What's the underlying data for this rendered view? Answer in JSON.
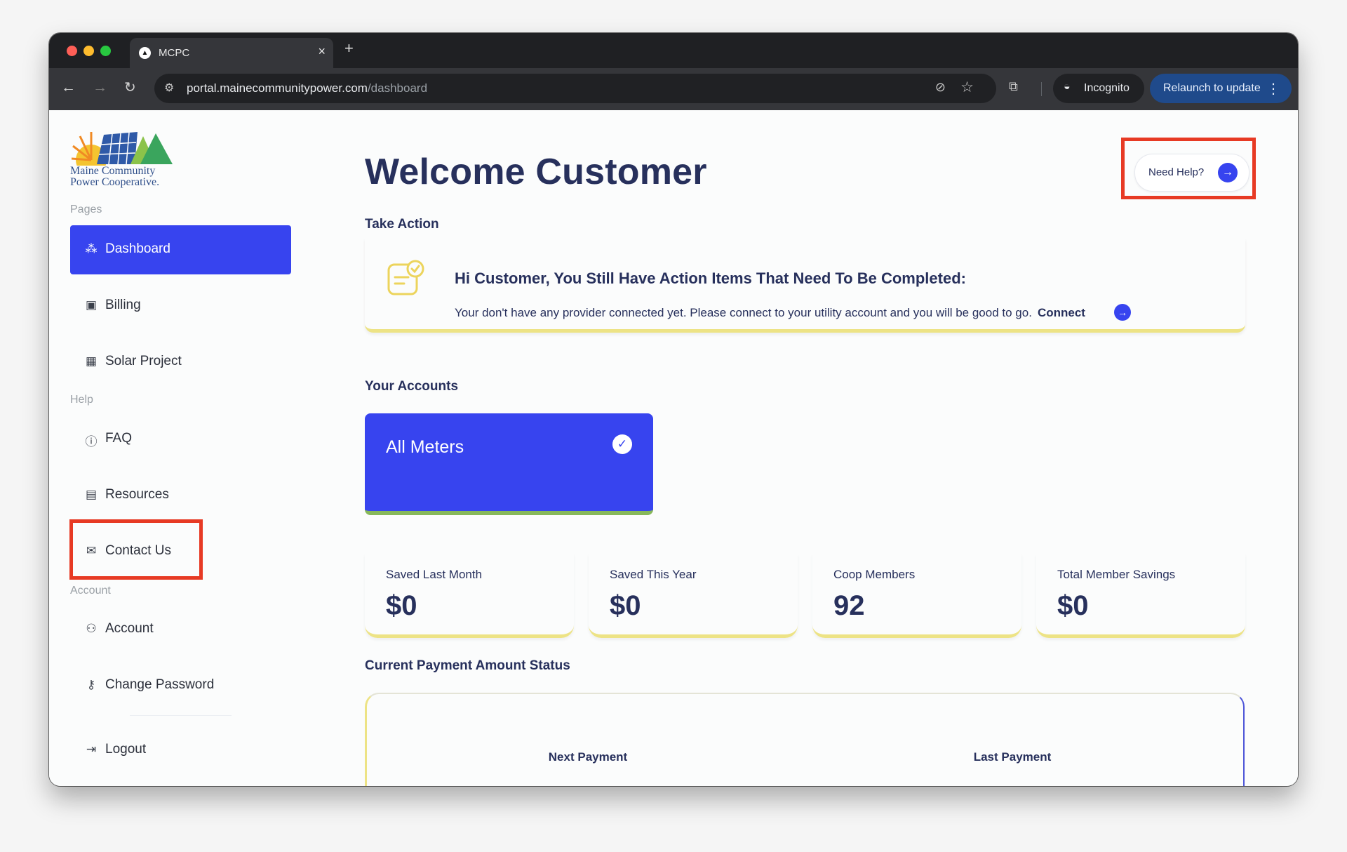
{
  "browser": {
    "tab_title": "MCPC",
    "tab_close": "×",
    "new_tab": "+",
    "url_host": "portal.mainecommunitypower.com",
    "url_path": "/dashboard",
    "incognito_label": "Incognito",
    "relaunch_label": "Relaunch to update"
  },
  "logo": {
    "line1": "Maine Community",
    "line2": "Power Cooperative."
  },
  "sidebar": {
    "pages_label": "Pages",
    "help_label": "Help",
    "account_label": "Account",
    "items": [
      {
        "label": "Dashboard",
        "icon": "dashboard-icon",
        "active": true
      },
      {
        "label": "Billing",
        "icon": "billing-icon"
      },
      {
        "label": "Solar Project",
        "icon": "solar-panel-icon"
      },
      {
        "label": "FAQ",
        "icon": "faq-icon"
      },
      {
        "label": "Resources",
        "icon": "resources-icon"
      },
      {
        "label": "Contact Us",
        "icon": "mail-icon"
      },
      {
        "label": "Account",
        "icon": "user-icon"
      },
      {
        "label": "Change Password",
        "icon": "key-icon"
      },
      {
        "label": "Logout",
        "icon": "logout-icon"
      }
    ]
  },
  "main": {
    "title": "Welcome Customer",
    "need_help": "Need Help?",
    "take_action_heading": "Take Action",
    "action": {
      "title": "Hi Customer, You Still Have Action Items That Need To Be Completed:",
      "text": "Your don't have any provider connected yet. Please connect to your utility account and you will be good to go.",
      "connect": "Connect"
    },
    "accounts_heading": "Your Accounts",
    "meter_label": "All Meters",
    "stats": [
      {
        "label": "Saved Last Month",
        "value": "$0"
      },
      {
        "label": "Saved This Year",
        "value": "$0"
      },
      {
        "label": "Coop Members",
        "value": "92"
      },
      {
        "label": "Total Member Savings",
        "value": "$0"
      }
    ],
    "payment_heading": "Current Payment Amount Status",
    "next_payment_label": "Next Payment",
    "last_payment_label": "Last Payment"
  },
  "colors": {
    "primary": "#3744ef",
    "navy": "#27305c",
    "accent_yellow": "#ede385",
    "highlight_red": "#e73a24",
    "meter_border_green": "#87b85a"
  }
}
